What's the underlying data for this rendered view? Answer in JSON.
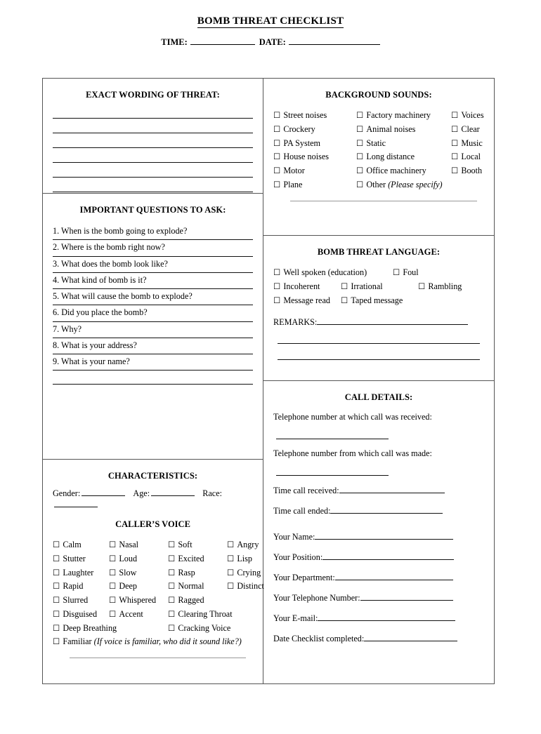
{
  "document": {
    "title": "BOMB THREAT CHECKLIST",
    "time_label": "TIME:",
    "date_label": "DATE:"
  },
  "exact_wording": {
    "heading": "EXACT WORDING OF THREAT:",
    "blank_lines": 6
  },
  "important_questions": {
    "heading": "IMPORTANT QUESTIONS TO ASK:",
    "items": [
      "1. When is the bomb going to explode?",
      "2. Where is the bomb right now?",
      "3. What does the bomb look like?",
      "4. What kind of bomb is it?",
      "5. What will cause the bomb to explode?",
      "6. Did you place the bomb?",
      "7. Why?",
      "8. What is your address?",
      "9. What is your name?"
    ]
  },
  "characteristics": {
    "heading": "CHARACTERISTICS:",
    "gender_label": "Gender:",
    "age_label": "Age:",
    "race_label": "Race:",
    "voice_heading": "CALLER’S VOICE",
    "voice_rows": [
      [
        "Calm",
        "Nasal",
        "Soft",
        "Angry"
      ],
      [
        "Stutter",
        "Loud",
        "Excited",
        "Lisp"
      ],
      [
        "Laughter",
        "Slow",
        "Rasp",
        "Crying"
      ],
      [
        "Rapid",
        "Deep",
        "Normal",
        "Distinct"
      ],
      [
        "Slurred",
        "Whispered",
        "Ragged"
      ]
    ],
    "voice_row_6": [
      "Disguised",
      "Accent",
      "Clearing Throat"
    ],
    "voice_row_7": [
      "Deep Breathing",
      "Cracking Voice"
    ],
    "familiar_label": "Familiar",
    "familiar_note": "(If voice is familiar, who did it sound like?)"
  },
  "background_sounds": {
    "heading": "BACKGROUND SOUNDS:",
    "rows": [
      [
        "Street noises",
        "Factory machinery",
        "Voices"
      ],
      [
        "Crockery",
        "Animal noises",
        "Clear"
      ],
      [
        "PA System",
        "Static",
        "Music"
      ],
      [
        "House noises",
        "Long distance",
        "Local"
      ],
      [
        "Motor",
        "Office machinery",
        "Booth"
      ]
    ],
    "last_row": [
      "Plane",
      "Other"
    ],
    "other_note": "(Please specify)"
  },
  "bomb_threat_language": {
    "heading": "BOMB THREAT LANGUAGE:",
    "row1": [
      "Well spoken (education)",
      "Foul"
    ],
    "row2": [
      "Incoherent",
      "Irrational",
      "Rambling"
    ],
    "row3": [
      "Message read",
      "Taped message"
    ],
    "remarks_label": "REMARKS:"
  },
  "call_details": {
    "heading": "CALL DETAILS:",
    "phone_received_label": "Telephone number at which call was received:",
    "phone_made_label": "Telephone number from which call was made:",
    "time_received_label": "Time call received:",
    "time_ended_label": "Time call ended:",
    "your_name_label": "Your Name:",
    "your_position_label": "Your Position:",
    "your_department_label": "Your Department:",
    "your_telephone_label": "Your Telephone Number:",
    "your_email_label": "Your E-mail:",
    "date_completed_label": "Date Checklist completed:"
  },
  "icons": {
    "checkbox": "☐"
  },
  "colors": {
    "border": "#555555",
    "rule": "#111111",
    "text": "#000000"
  }
}
